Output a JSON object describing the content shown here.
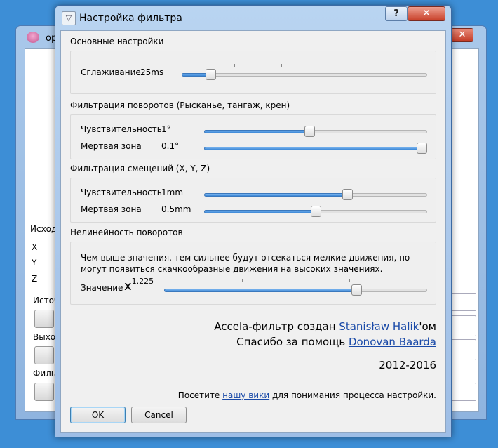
{
  "background_window": {
    "title": "op",
    "close_glyph": "✕",
    "labels": [
      "Исход",
      "X",
      "Y",
      "Z",
      "Источ",
      "Выход",
      "Фильт"
    ]
  },
  "dialog": {
    "title": "Настройка фильтра",
    "help_glyph": "?",
    "close_glyph": "✕",
    "app_icon": "filter-icon",
    "basic": {
      "title": "Основные настройки",
      "smoothing_label": "Сглаживание",
      "smoothing_value": "25ms",
      "smoothing_fraction": 0.1
    },
    "rotation": {
      "title": "Фильтрация поворотов (Рысканье, тангаж, крен)",
      "sensitivity_label": "Чувствительность",
      "sensitivity_value": "1°",
      "sensitivity_fraction": 0.47,
      "deadzone_label": "Мертвая зона",
      "deadzone_value": "0.1°",
      "deadzone_fraction": 1.0
    },
    "translation": {
      "title": "Фильтрация смещений (X, Y, Z)",
      "sensitivity_label": "Чувствительность",
      "sensitivity_value": "1mm",
      "sensitivity_fraction": 0.65,
      "deadzone_label": "Мертвая зона",
      "deadzone_value": "0.5mm",
      "deadzone_fraction": 0.5
    },
    "nonlinearity": {
      "title": "Нелинейность поворотов",
      "description": "Чем выше значения, тем сильнее будут отсекаться мелкие движения, но могут появиться скачкообразные движения на высоких значениях.",
      "value_label": "Значение",
      "x_symbol": "x",
      "exponent": "1.225",
      "fraction": 0.74
    },
    "credits": {
      "line1_prefix": "Accela-фильтр создан ",
      "line1_link": "Stanisław Halik",
      "line1_suffix": "'ом",
      "line2_prefix": "Спасибо за помощь ",
      "line2_link": "Donovan Baarda",
      "years": "2012-2016"
    },
    "visit": {
      "prefix": "Посетите ",
      "link": "нашу вики",
      "suffix": " для понимания процесса настройки."
    },
    "buttons": {
      "ok": "OK",
      "cancel": "Cancel"
    }
  },
  "colors": {
    "desktop": "#3d8ed6",
    "slider_fill": "#3a86d6",
    "link": "#1a4aa8",
    "close_button": "#c8412a"
  }
}
